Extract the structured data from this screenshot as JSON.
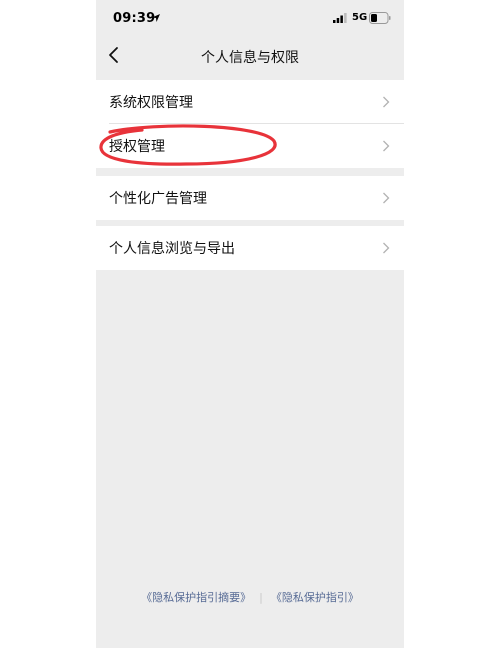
{
  "status_bar": {
    "time": "09:39",
    "network": "5G",
    "icons": [
      "location-arrow-icon",
      "signal-icon",
      "battery-icon"
    ]
  },
  "nav": {
    "title": "个人信息与权限",
    "back_icon": "chevron-left-icon"
  },
  "groups": [
    {
      "items": [
        {
          "label": "系统权限管理"
        },
        {
          "label": "授权管理"
        }
      ]
    },
    {
      "items": [
        {
          "label": "个性化广告管理"
        }
      ]
    },
    {
      "items": [
        {
          "label": "个人信息浏览与导出"
        }
      ]
    }
  ],
  "footer": {
    "link1": "《隐私保护指引摘要》",
    "separator": "|",
    "link2": "《隐私保护指引》"
  },
  "colors": {
    "background": "#ededed",
    "link": "#576b95",
    "annotation": "#e8333a"
  }
}
